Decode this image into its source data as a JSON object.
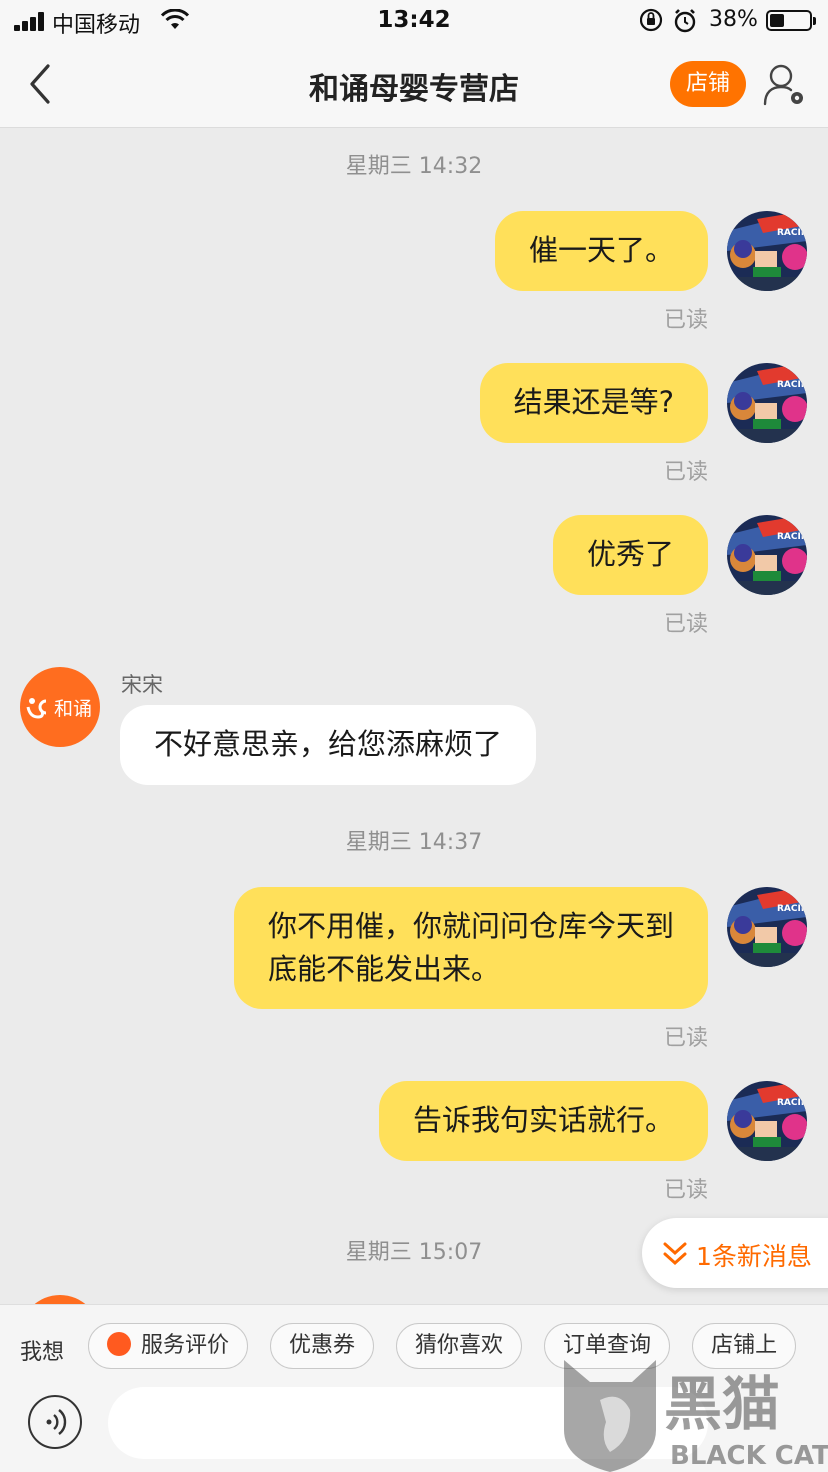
{
  "status_bar": {
    "carrier": "中国移动",
    "time": "13:42",
    "battery": "38%",
    "battery_level": 0.38
  },
  "header": {
    "title": "和诵母婴专营店",
    "store_button": "店铺"
  },
  "messages": [
    {
      "kind": "timestamp",
      "text": "星期三 14:32"
    },
    {
      "kind": "mine",
      "text": "催一天了。",
      "status": "已读"
    },
    {
      "kind": "mine",
      "text": "结果还是等?",
      "status": "已读"
    },
    {
      "kind": "mine",
      "text": "优秀了",
      "status": "已读"
    },
    {
      "kind": "theirs",
      "sender": "宋宋",
      "avatar_text": "和诵",
      "text": "不好意思亲，给您添麻烦了"
    },
    {
      "kind": "timestamp",
      "text": "星期三 14:37"
    },
    {
      "kind": "mine",
      "text_lines": [
        "你不用催，你就问问仓库今天到",
        "底能不能发出来。"
      ],
      "status": "已读"
    },
    {
      "kind": "mine",
      "text": "告诉我句实话就行。",
      "status": "已读"
    },
    {
      "kind": "timestamp",
      "text": "星期三 15:07"
    }
  ],
  "new_message_indicator": "1条新消息",
  "quick_bar": {
    "label": "我想",
    "chips": [
      "服务评价",
      "优惠券",
      "猜你喜欢",
      "订单查询",
      "店铺上"
    ]
  },
  "input": {
    "placeholder": ""
  },
  "watermark": {
    "text": "黑猫",
    "subtext": "BLACK CAT"
  },
  "colors": {
    "accent": "#ff7300",
    "my_bubble": "#ffe05a",
    "their_bubble": "#ffffff",
    "background": "#ebebeb"
  }
}
